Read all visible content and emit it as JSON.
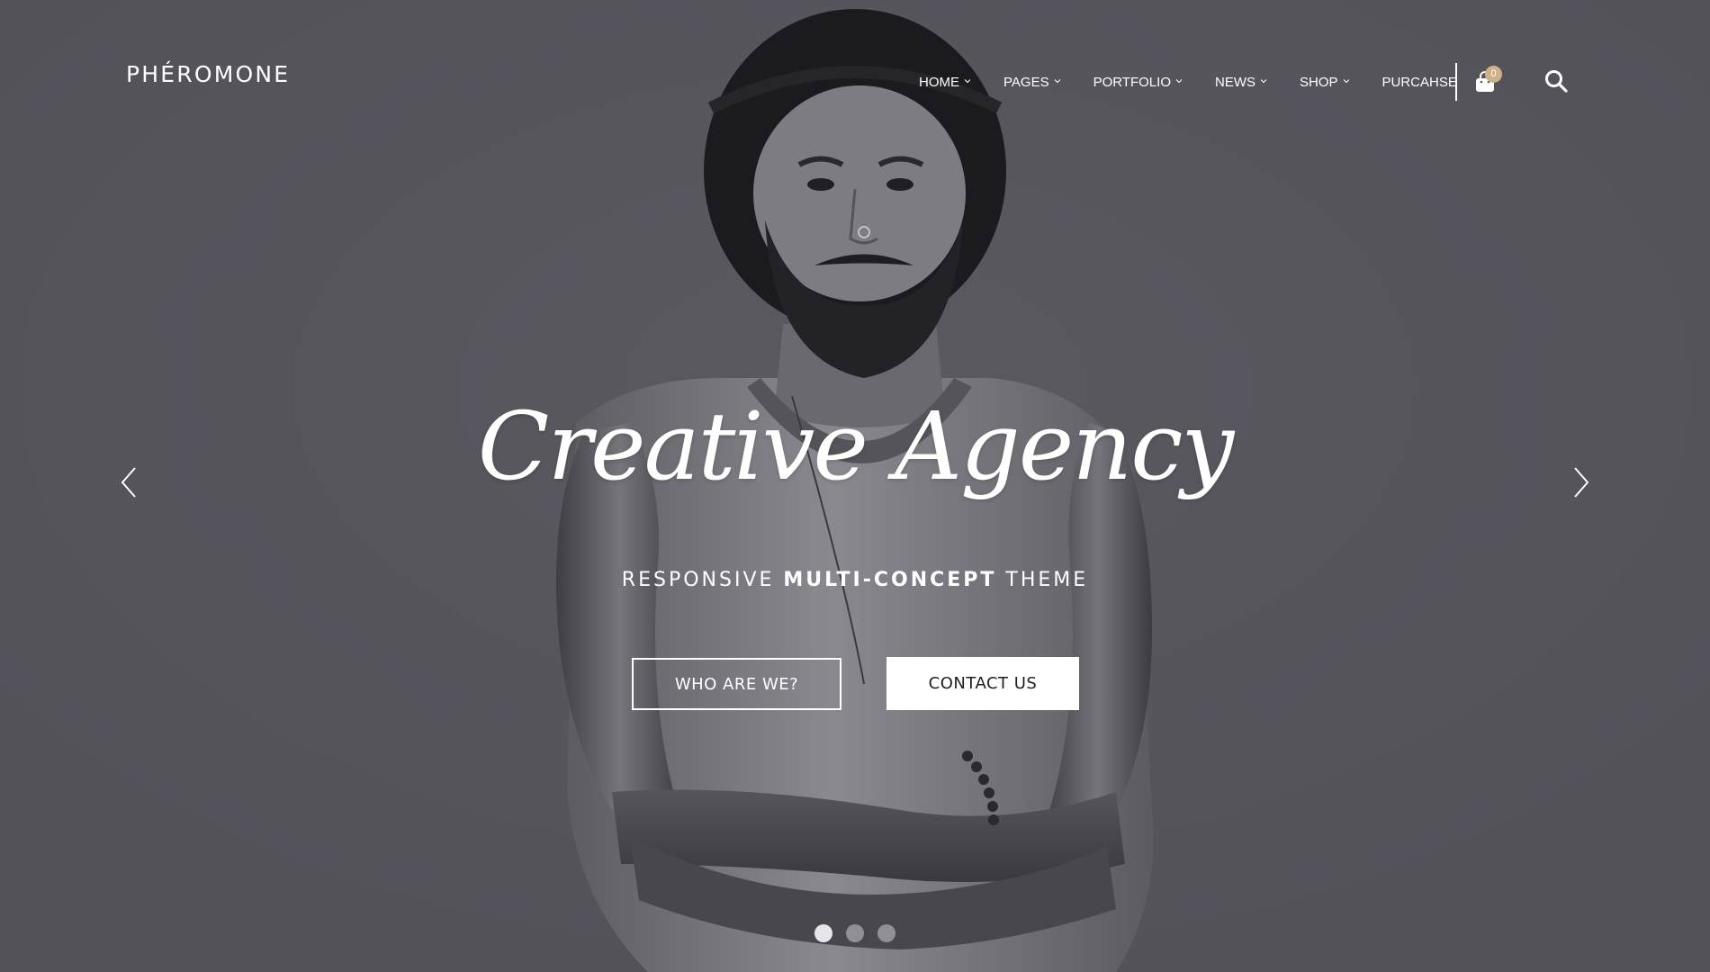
{
  "header": {
    "logo": "PHÉROMONE",
    "nav": [
      {
        "label": "HOME",
        "has_dropdown": true
      },
      {
        "label": "PAGES",
        "has_dropdown": true
      },
      {
        "label": "PORTFOLIO",
        "has_dropdown": true
      },
      {
        "label": "NEWS",
        "has_dropdown": true
      },
      {
        "label": "SHOP",
        "has_dropdown": true
      },
      {
        "label": "PURCAHSE",
        "has_dropdown": false
      }
    ],
    "cart_count": "0",
    "cart_icon": "shopping-bag-icon",
    "search_icon": "search-icon"
  },
  "hero": {
    "title": "Creative Agency",
    "subtitle_pre": "RESPONSIVE ",
    "subtitle_strong": "MULTI-CONCEPT",
    "subtitle_post": " THEME",
    "btn_primary": "WHO ARE WE?",
    "btn_secondary": "CONTACT US",
    "prev_icon": "chevron-left-icon",
    "next_icon": "chevron-right-icon"
  },
  "slider": {
    "slide_count": 3,
    "active_index": 0
  },
  "colors": {
    "background": "#55545b",
    "accent_badge": "#cdb18a",
    "text": "#ffffff"
  }
}
